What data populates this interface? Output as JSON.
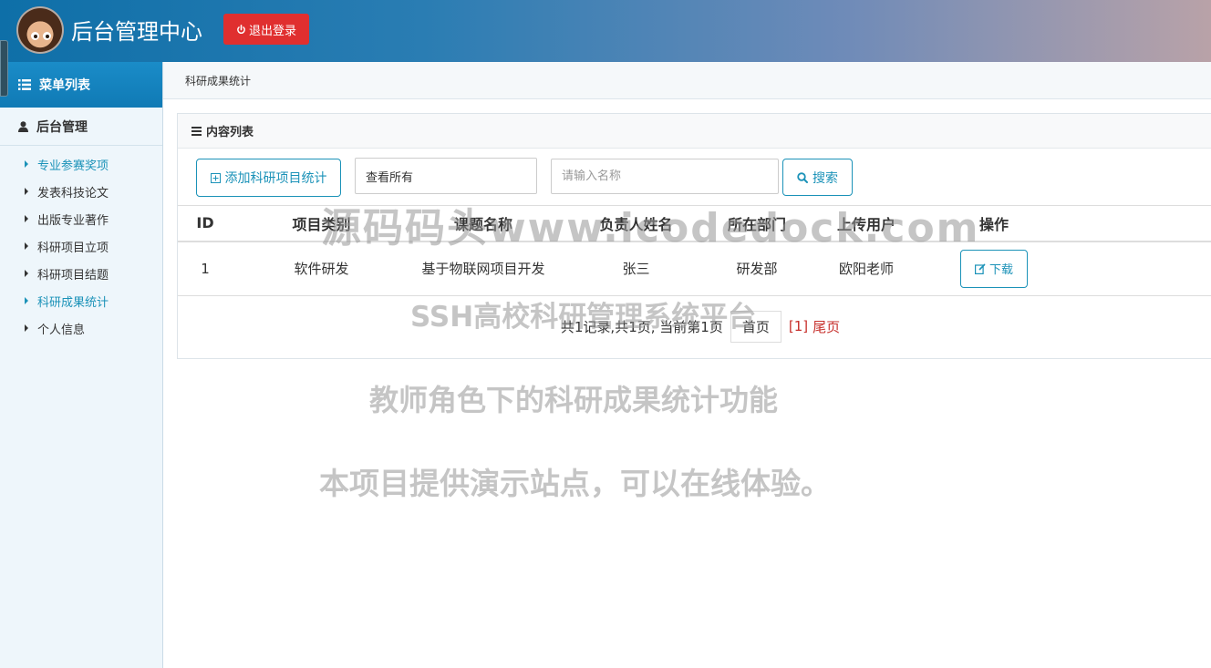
{
  "header": {
    "title": "后台管理中心",
    "logout_label": "退出登录"
  },
  "sidebar": {
    "heading": "菜单列表",
    "group": "后台管理",
    "items": [
      {
        "label": "专业参赛奖项",
        "active": true
      },
      {
        "label": "发表科技论文",
        "active": false
      },
      {
        "label": "出版专业著作",
        "active": false
      },
      {
        "label": "科研项目立项",
        "active": false
      },
      {
        "label": "科研项目结题",
        "active": false
      },
      {
        "label": "科研成果统计",
        "active": true
      },
      {
        "label": "个人信息",
        "active": false
      }
    ]
  },
  "breadcrumb": "科研成果统计",
  "panel": {
    "title": "内容列表",
    "add_label": "添加科研项目统计",
    "filter_value": "查看所有",
    "search_placeholder": "请输入名称",
    "search_label": "搜索"
  },
  "table": {
    "headers": [
      "ID",
      "项目类别",
      "课题名称",
      "负责人姓名",
      "所在部门",
      "上传用户",
      "操作"
    ],
    "rows": [
      {
        "id": "1",
        "category": "软件研发",
        "topic": "基于物联网项目开发",
        "owner": "张三",
        "dept": "研发部",
        "uploader": "欧阳老师",
        "action": "下载"
      }
    ]
  },
  "pager": {
    "summary": "共1记录,共1页, 当前第1页",
    "first": "首页",
    "current": "[1]",
    "last": "尾页"
  },
  "watermarks": [
    "源码码头www.icodedock.com",
    "SSH高校科研管理系统平台",
    "教师角色下的科研成果统计功能",
    "本项目提供演示站点，可以在线体验。"
  ],
  "colors": {
    "accent": "#1b92b8",
    "danger": "#e02f2f",
    "header_start": "#0e6fa8",
    "header_end": "#b9a2a8"
  }
}
